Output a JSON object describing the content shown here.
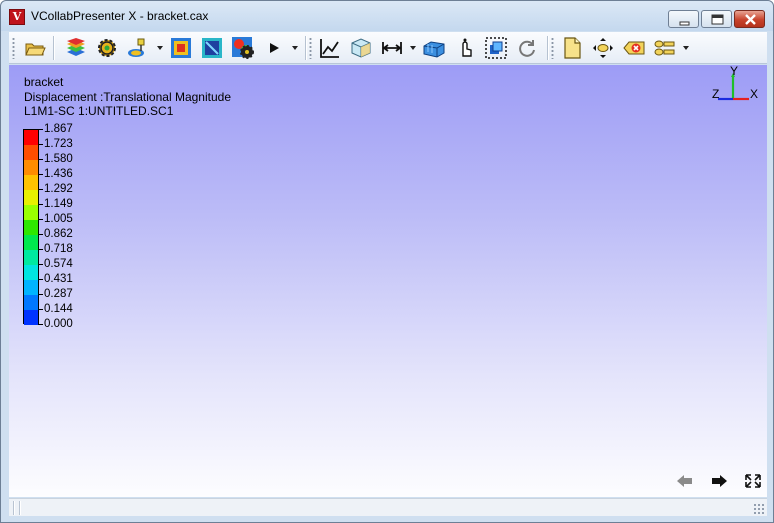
{
  "window": {
    "title": "VCollabPresenter X - bracket.cax",
    "logo_letter": "V"
  },
  "toolbar": {
    "icons": [
      "open-folder-icon",
      "layers-icon",
      "settings-gear-icon",
      "probe-icon",
      "contour-icon",
      "fringe-icon",
      "results-gear-icon",
      "play-icon",
      "graph-icon",
      "cube-view-icon",
      "measure-icon",
      "model-icon",
      "pick-icon",
      "select-box-icon",
      "refresh-icon",
      "new-document-icon",
      "pan-icon",
      "clear-icon",
      "views-icon"
    ]
  },
  "viewport": {
    "model_name": "bracket",
    "result_label": "Displacement :Translational Magnitude",
    "case_label": "L1M1-SC 1:UNTITLED.SC1",
    "axes": {
      "x": "X",
      "y": "Y",
      "z": "Z"
    }
  },
  "legend": {
    "values": [
      "1.867",
      "1.723",
      "1.580",
      "1.436",
      "1.292",
      "1.149",
      "1.005",
      "0.862",
      "0.718",
      "0.574",
      "0.431",
      "0.287",
      "0.144",
      "0.000"
    ],
    "colors": [
      "#ff0000",
      "#ff4d00",
      "#ff8c00",
      "#ffc200",
      "#e8f000",
      "#9aff00",
      "#2ee800",
      "#00e84d",
      "#00eaa0",
      "#00e5e0",
      "#00b4ff",
      "#0078ff",
      "#0033ff"
    ]
  },
  "colors": {
    "viewport_top": "#9d9cf6",
    "viewport_bottom": "#fdfdff",
    "close_button": "#c8432c"
  }
}
